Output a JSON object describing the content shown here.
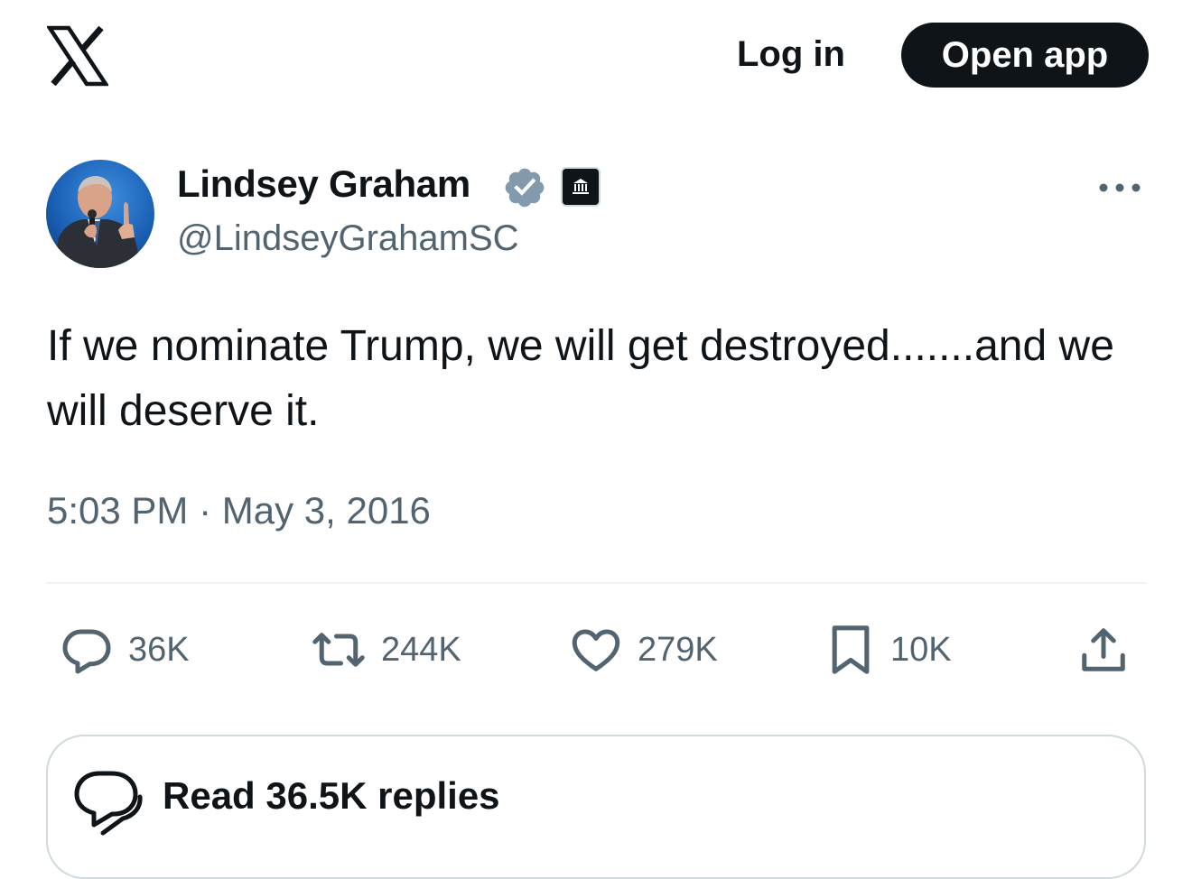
{
  "header": {
    "logo_icon": "x-logo-icon",
    "login_label": "Log in",
    "open_app_label": "Open app"
  },
  "tweet": {
    "author": {
      "name": "Lindsey Graham",
      "handle": "@LindseyGrahamSC",
      "verified_icon": "verified-badge-icon",
      "verified_color": "#829aab",
      "affiliation_icon": "government-building-icon"
    },
    "more_icon": "more-dots-icon",
    "text": "If we nominate Trump, we will get destroyed.......and we will deserve it.",
    "time": "5:03 PM",
    "separator": "·",
    "date": "May 3, 2016",
    "stats": {
      "replies": "36K",
      "reposts": "244K",
      "likes": "279K",
      "bookmarks": "10K"
    },
    "read_replies_label": "Read 36.5K replies"
  },
  "colors": {
    "text_primary": "#0f1419",
    "text_secondary": "#536471",
    "button_dark": "#0f1419",
    "border": "#cfd9de"
  }
}
